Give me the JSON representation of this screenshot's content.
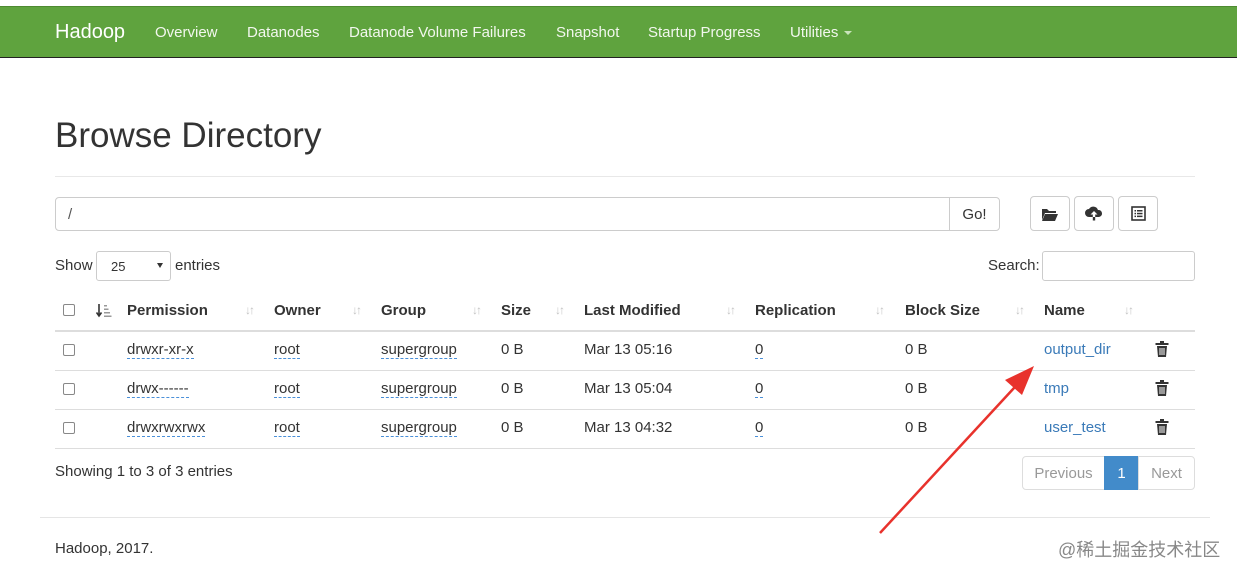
{
  "navbar": {
    "brand": "Hadoop",
    "items": [
      "Overview",
      "Datanodes",
      "Datanode Volume Failures",
      "Snapshot",
      "Startup Progress",
      "Utilities"
    ],
    "color": "#5fa33e"
  },
  "page_title": "Browse Directory",
  "path": {
    "value": "/",
    "go_label": "Go!"
  },
  "toolbar_icons": [
    "folder-open-icon",
    "cloud-upload-icon",
    "list-alt-icon"
  ],
  "length": {
    "show": "Show",
    "value": "25",
    "entries": "entries"
  },
  "search": {
    "label": "Search:",
    "value": ""
  },
  "table": {
    "headers": [
      "Permission",
      "Owner",
      "Group",
      "Size",
      "Last Modified",
      "Replication",
      "Block Size",
      "Name"
    ],
    "rows": [
      {
        "permission": "drwxr-xr-x",
        "owner": "root",
        "group": "supergroup",
        "size": "0 B",
        "modified": "Mar 13 05:16",
        "replication": "0",
        "block_size": "0 B",
        "name": "output_dir"
      },
      {
        "permission": "drwx------",
        "owner": "root",
        "group": "supergroup",
        "size": "0 B",
        "modified": "Mar 13 05:04",
        "replication": "0",
        "block_size": "0 B",
        "name": "tmp"
      },
      {
        "permission": "drwxrwxrwx",
        "owner": "root",
        "group": "supergroup",
        "size": "0 B",
        "modified": "Mar 13 04:32",
        "replication": "0",
        "block_size": "0 B",
        "name": "user_test"
      }
    ]
  },
  "info": "Showing 1 to 3 of 3 entries",
  "pagination": {
    "previous": "Previous",
    "page": "1",
    "next": "Next"
  },
  "footer": "Hadoop, 2017.",
  "watermark": "@稀土掘金技术社区",
  "annotation": {
    "type": "red-arrow",
    "color": "#e8322c"
  }
}
